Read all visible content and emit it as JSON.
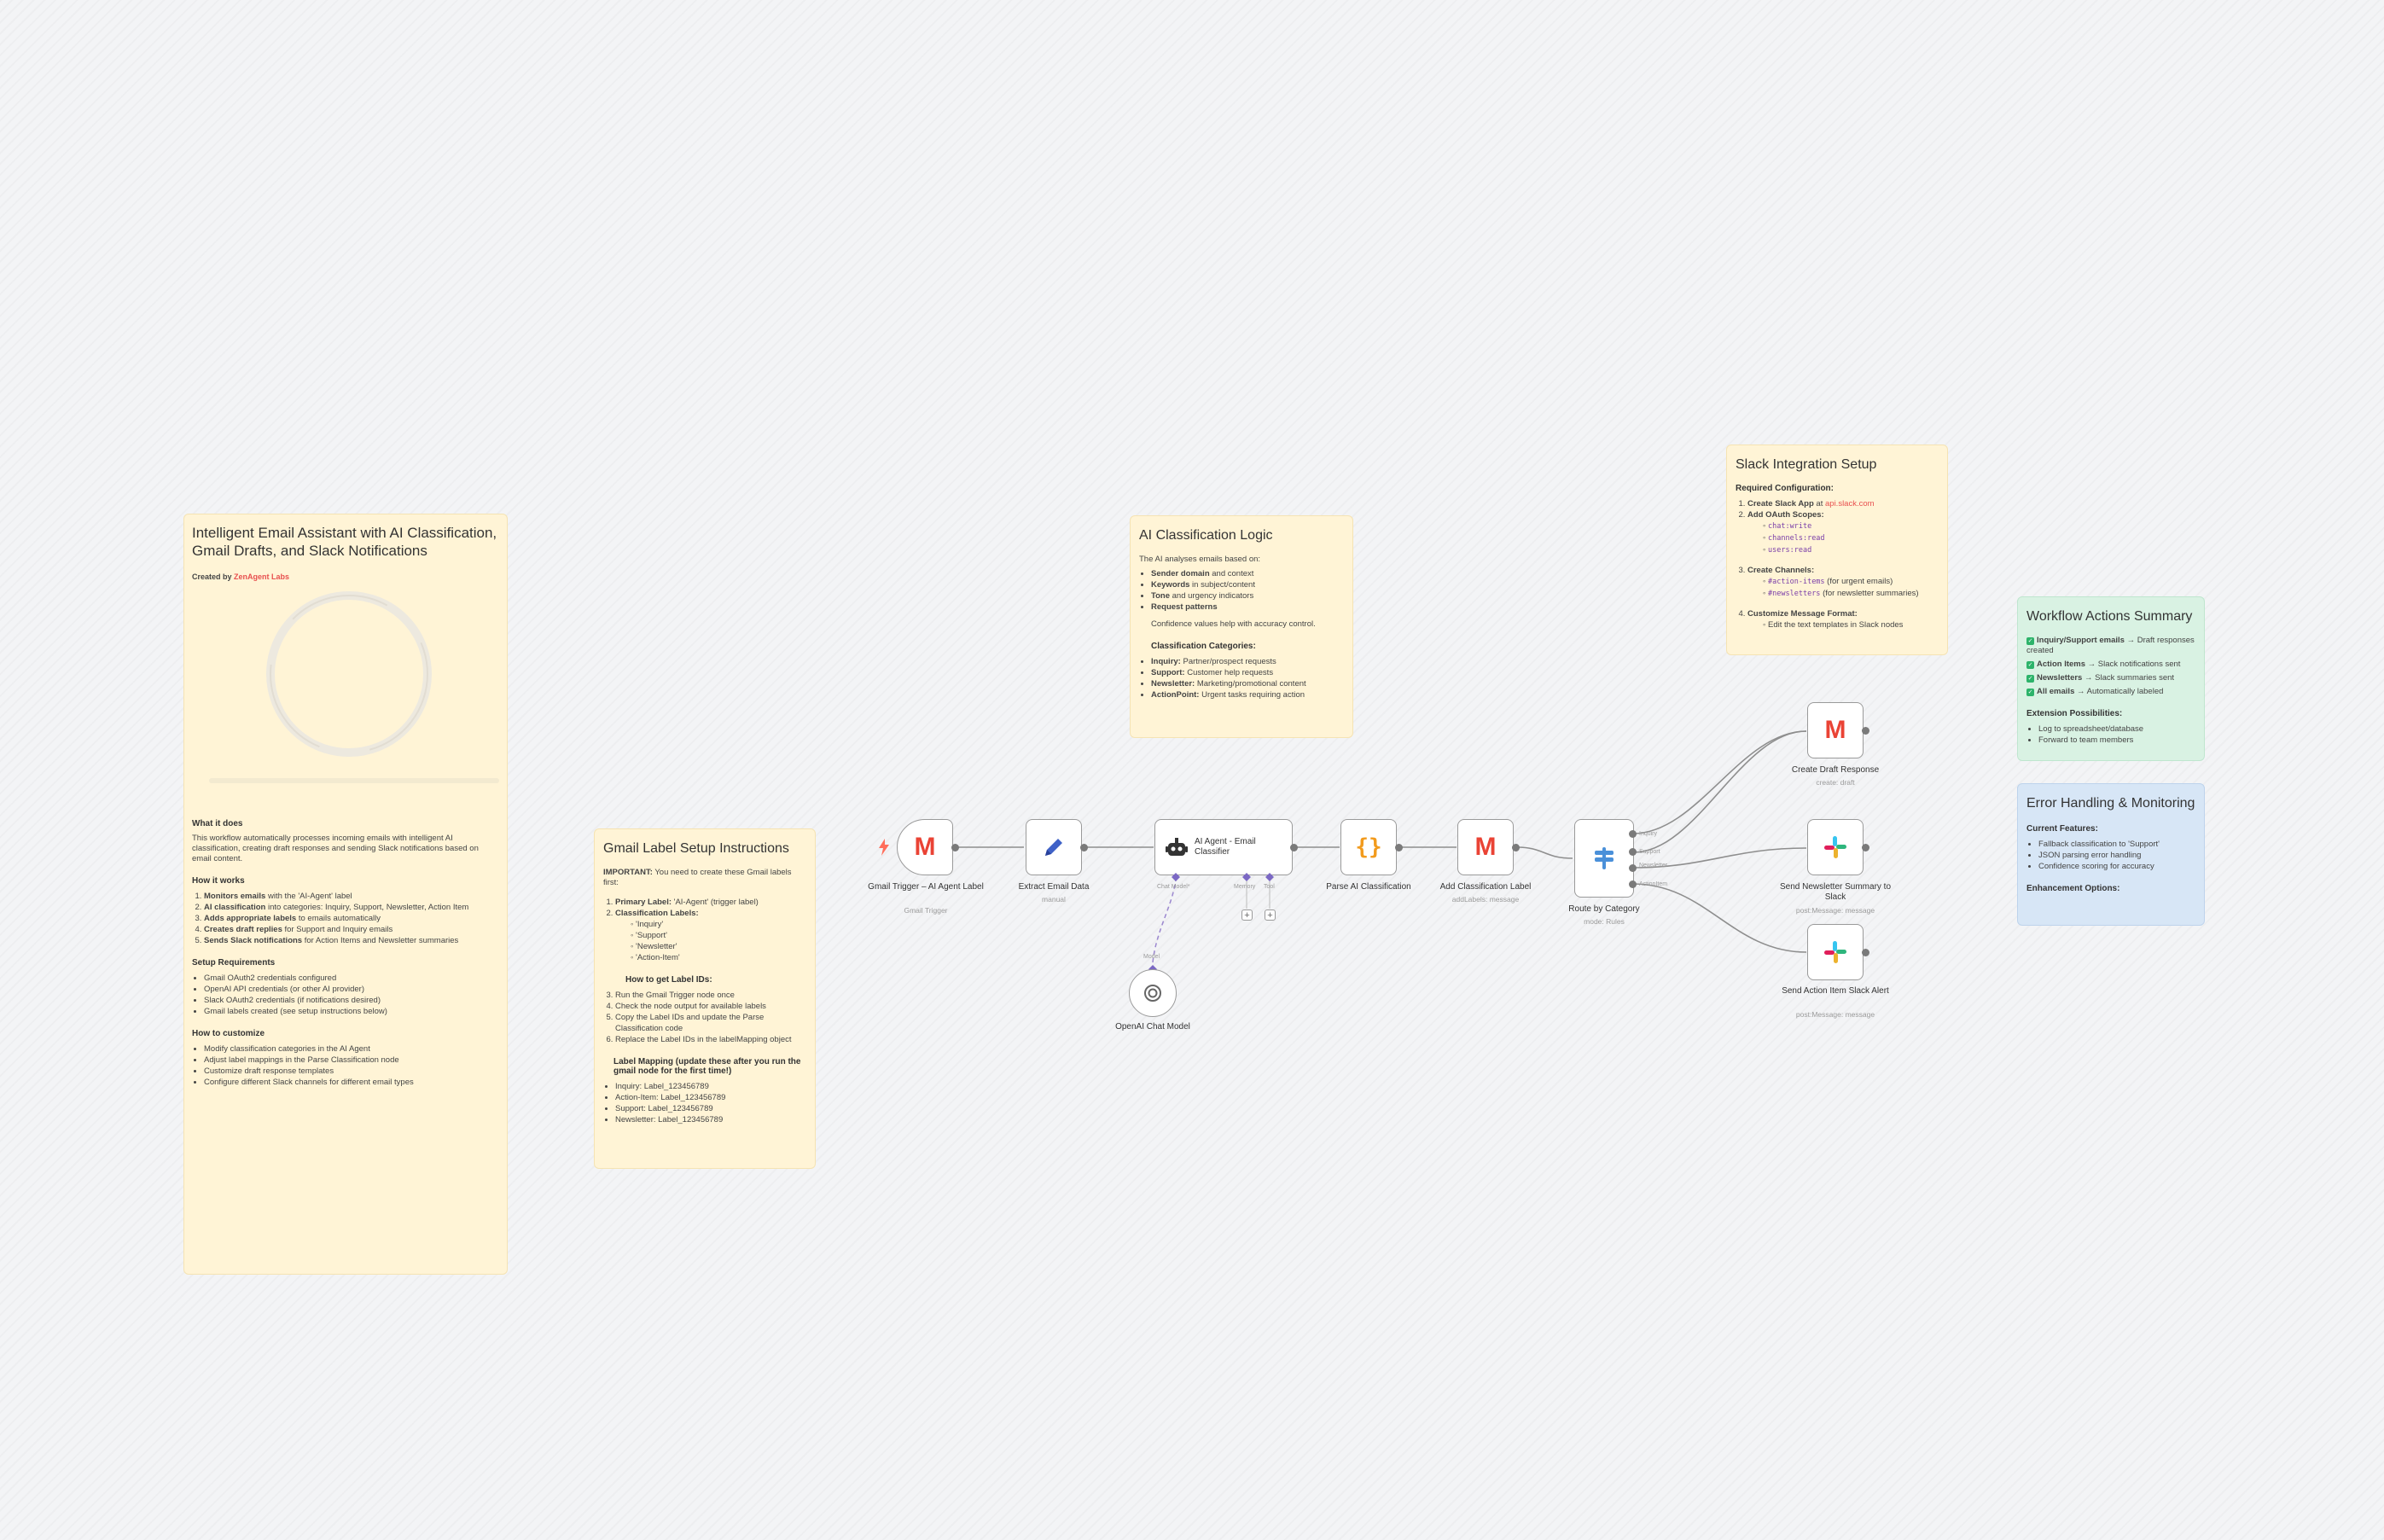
{
  "notes": {
    "intro": {
      "title": "Intelligent Email Assistant with AI Classification, Gmail Drafts, and Slack Notifications",
      "created_by_prefix": "Created by",
      "created_by_name": "ZenAgent Labs",
      "what_heading": "What it does",
      "what_text": "This workflow automatically processes incoming emails with intelligent AI classification, creating draft responses and sending Slack notifications based on email content.",
      "how_heading": "How it works",
      "how_items": [
        {
          "bold": "Monitors emails",
          "rest": " with the 'AI-Agent' label"
        },
        {
          "bold": "AI classification",
          "rest": " into categories: Inquiry, Support, Newsletter, Action Item"
        },
        {
          "bold": "Adds appropriate labels",
          "rest": " to emails automatically"
        },
        {
          "bold": "Creates draft replies",
          "rest": " for Support and Inquiry emails"
        },
        {
          "bold": "Sends Slack notifications",
          "rest": " for Action Items and Newsletter summaries"
        }
      ],
      "setup_heading": "Setup Requirements",
      "setup_items": [
        "Gmail OAuth2 credentials configured",
        "OpenAI API credentials (or other AI provider)",
        "Slack OAuth2 credentials (if notifications desired)",
        "Gmail labels created (see setup instructions below)"
      ],
      "customize_heading": "How to customize",
      "customize_items": [
        "Modify classification categories in the AI Agent",
        "Adjust label mappings in the Parse Classification node",
        "Customize draft response templates",
        "Configure different Slack channels for different email types"
      ]
    },
    "gmail_setup": {
      "title": "Gmail Label Setup Instructions",
      "important_bold": "IMPORTANT:",
      "important_rest": " You need to create these Gmail labels first:",
      "step1_bold": "Primary Label:",
      "step1_rest": " 'AI-Agent' (trigger label)",
      "step2_bold": "Classification Labels:",
      "labels": [
        "'Inquiry'",
        "'Support'",
        "'Newsletter'",
        "'Action-Item'"
      ],
      "get_ids_heading": "How to get Label IDs:",
      "get_ids_steps": [
        "Run the Gmail Trigger node once",
        "Check the node output for available labels",
        "Copy the Label IDs and update the Parse Classification code",
        "Replace the Label IDs in the labelMapping object"
      ],
      "mapping_heading": "Label Mapping (update these after you run the gmail node for the first time!)",
      "mapping_items": [
        "Inquiry: Label_123456789",
        "Action-Item: Label_123456789",
        "Support: Label_123456789",
        "Newsletter: Label_123456789"
      ]
    },
    "ai_logic": {
      "title": "AI Classification Logic",
      "intro": "The AI analyses emails based on:",
      "bases": [
        {
          "bold": "Sender domain",
          "rest": " and context"
        },
        {
          "bold": "Keywords",
          "rest": " in subject/content"
        },
        {
          "bold": "Tone",
          "rest": " and urgency indicators"
        },
        {
          "bold": "Request patterns",
          "rest": ""
        }
      ],
      "confidence": "Confidence values help with accuracy control.",
      "categories_heading": "Classification Categories:",
      "categories": [
        {
          "bold": "Inquiry:",
          "rest": " Partner/prospect requests"
        },
        {
          "bold": "Support:",
          "rest": " Customer help requests"
        },
        {
          "bold": "Newsletter:",
          "rest": " Marketing/promotional content"
        },
        {
          "bold": "ActionPoint:",
          "rest": " Urgent tasks requiring action"
        }
      ]
    },
    "slack_setup": {
      "title": "Slack Integration Setup",
      "required_heading": "Required Configuration:",
      "step1_bold": "Create Slack App",
      "step1_mid": " at ",
      "step1_link": "api.slack.com",
      "step2_bold": "Add OAuth Scopes:",
      "scopes": [
        "chat:write",
        "channels:read",
        "users:read"
      ],
      "step3_bold": "Create Channels:",
      "channels": [
        {
          "code": "#action-items",
          "rest": " (for urgent emails)"
        },
        {
          "code": "#newsletters",
          "rest": " (for newsletter summaries)"
        }
      ],
      "step4_bold": "Customize Message Format:",
      "step4_sub": "Edit the text templates in Slack nodes"
    },
    "actions_summary": {
      "title": "Workflow Actions Summary",
      "items": [
        {
          "bold": "Inquiry/Support emails",
          "rest": " → Draft responses created"
        },
        {
          "bold": "Action Items",
          "rest": " → Slack notifications sent"
        },
        {
          "bold": "Newsletters",
          "rest": " → Slack summaries sent"
        },
        {
          "bold": "All emails",
          "rest": " → Automatically labeled"
        }
      ],
      "ext_heading": "Extension Possibilities:",
      "ext_items": [
        "Log to spreadsheet/database",
        "Forward to team members"
      ]
    },
    "error_handling": {
      "title": "Error Handling & Monitoring",
      "current_heading": "Current Features:",
      "current_items": [
        "Fallback classification to 'Support'",
        "JSON parsing error handling",
        "Confidence scoring for accuracy"
      ],
      "enh_heading": "Enhancement Options:"
    }
  },
  "nodes": {
    "gmail_trigger": {
      "title": "Gmail Trigger – AI Agent Label",
      "sub": "Gmail Trigger",
      "icon": "gmail-icon"
    },
    "extract": {
      "title": "Extract Email Data",
      "sub": "manual",
      "icon": "pencil-icon"
    },
    "agent": {
      "title": "AI Agent - Email Classifier",
      "chat_model_port": "Chat Model*",
      "memory_port": "Memory",
      "tool_port": "Tool",
      "icon": "robot-icon"
    },
    "parse": {
      "title": "Parse AI Classification",
      "icon": "braces-icon"
    },
    "add_label": {
      "title": "Add Classification Label",
      "sub": "addLabels: message",
      "icon": "gmail-icon"
    },
    "route": {
      "title": "Route by Category",
      "sub": "mode: Rules",
      "outputs": [
        "Inquiry",
        "Support",
        "Newsletter",
        "ActionItem"
      ],
      "icon": "switch-icon"
    },
    "create_draft": {
      "title": "Create Draft Response",
      "sub": "create: draft",
      "icon": "gmail-icon"
    },
    "send_newsletter": {
      "title": "Send Newsletter Summary to Slack",
      "sub": "post:Message: message",
      "icon": "slack-icon"
    },
    "send_action": {
      "title": "Send Action Item Slack Alert",
      "sub": "post:Message: message",
      "icon": "slack-icon"
    },
    "openai": {
      "title": "OpenAI Chat Model",
      "port": "Model",
      "icon": "openai-icon"
    }
  },
  "colors": {
    "gmail_red": "#ea4335",
    "note_yellow": "#fff4d6",
    "note_green": "#d9f2e3",
    "note_blue": "#d7e6f6",
    "accent": "#e8504f"
  }
}
